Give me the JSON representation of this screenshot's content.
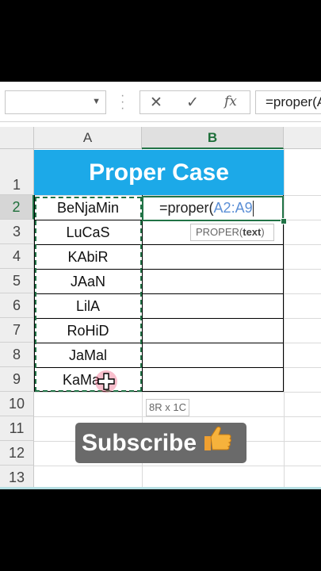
{
  "formula_bar": {
    "name_box": "",
    "cancel_icon": "✕",
    "enter_icon": "✓",
    "fx_icon": "fx",
    "formula_text": "=proper(A"
  },
  "columns": [
    "A",
    "B"
  ],
  "rows": [
    "1",
    "2",
    "3",
    "4",
    "5",
    "6",
    "7",
    "8",
    "9",
    "10",
    "11",
    "12",
    "13"
  ],
  "title": "Proper Case",
  "names": [
    "BeNjaMin",
    "LuCaS",
    "KAbiR",
    "JAaN",
    "LilA",
    "RoHiD",
    "JaMal",
    "KaMa"
  ],
  "active_cell": {
    "formula_prefix": "=proper(",
    "formula_ref": "A2:A9"
  },
  "tooltip": {
    "function": "PROPER(",
    "arg": "text",
    "close": ")"
  },
  "selection_size": "8R x 1C",
  "overlay": {
    "subscribe": "Subscribe"
  },
  "colors": {
    "title_bg": "#1ca9e8",
    "excel_green": "#217346",
    "subscribe_bg": "#6a6a6a"
  }
}
